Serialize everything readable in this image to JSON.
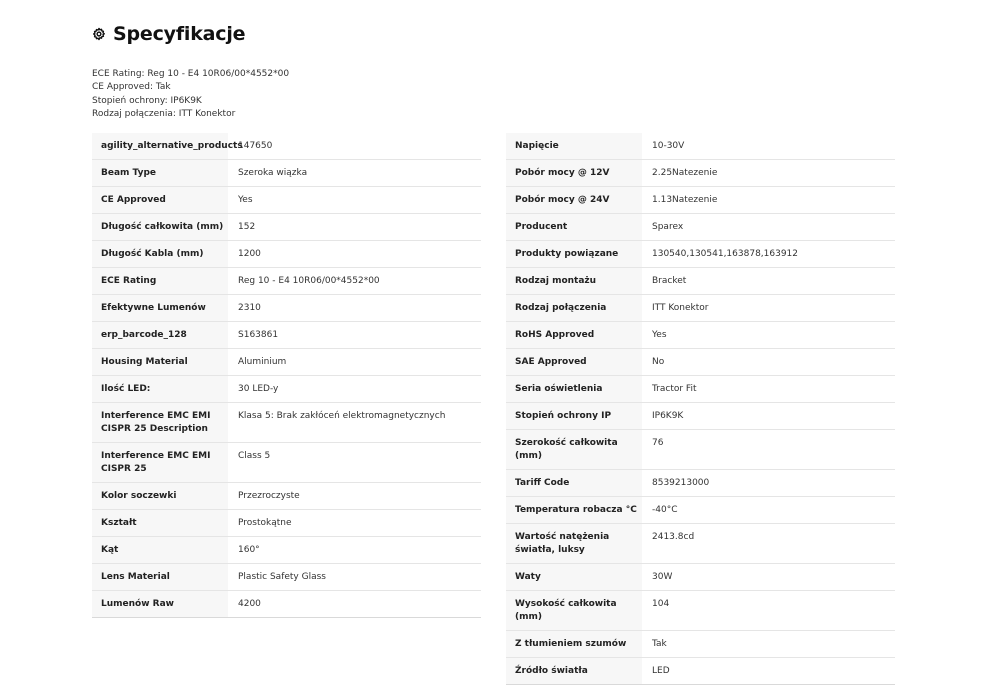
{
  "heading": {
    "icon": "gear-icon",
    "title": "Specyfikacje"
  },
  "summary": [
    "ECE Rating: Reg 10 - E4 10R06/00*4552*00",
    "CE Approved: Tak",
    "Stopień ochrony: IP6K9K",
    "Rodzaj połączenia: ITT Konektor"
  ],
  "left_table": [
    {
      "label": "agility_alternative_products",
      "value": "147650"
    },
    {
      "label": "Beam Type",
      "value": "Szeroka wiązka"
    },
    {
      "label": "CE Approved",
      "value": "Yes"
    },
    {
      "label": "Długość całkowita (mm)",
      "value": "152"
    },
    {
      "label": "Długość Kabla (mm)",
      "value": "1200"
    },
    {
      "label": "ECE Rating",
      "value": "Reg 10 - E4 10R06/00*4552*00"
    },
    {
      "label": "Efektywne Lumenów",
      "value": "2310"
    },
    {
      "label": "erp_barcode_128",
      "value": "S163861"
    },
    {
      "label": "Housing Material",
      "value": "Aluminium"
    },
    {
      "label": "Ilość LED:",
      "value": "30 LED-y"
    },
    {
      "label": "Interference EMC EMI CISPR 25 Description",
      "value": "Klasa 5: Brak zakłóceń elektromagnetycznych"
    },
    {
      "label": "Interference EMC EMI CISPR 25",
      "value": "Class 5"
    },
    {
      "label": "Kolor soczewki",
      "value": "Przezroczyste"
    },
    {
      "label": "Kształt",
      "value": "Prostokątne"
    },
    {
      "label": "Kąt",
      "value": "160°"
    },
    {
      "label": "Lens Material",
      "value": "Plastic Safety Glass"
    },
    {
      "label": "Lumenów Raw",
      "value": "4200"
    }
  ],
  "right_table": [
    {
      "label": "Napięcie",
      "value": "10-30V"
    },
    {
      "label": "Pobór mocy @ 12V",
      "value": "2.25Natezenie"
    },
    {
      "label": "Pobór mocy @ 24V",
      "value": "1.13Natezenie"
    },
    {
      "label": "Producent",
      "value": "Sparex"
    },
    {
      "label": "Produkty powiązane",
      "value": "130540,130541,163878,163912"
    },
    {
      "label": "Rodzaj montażu",
      "value": "Bracket"
    },
    {
      "label": "Rodzaj połączenia",
      "value": "ITT Konektor"
    },
    {
      "label": "RoHS Approved",
      "value": "Yes"
    },
    {
      "label": "SAE Approved",
      "value": "No"
    },
    {
      "label": "Seria oświetlenia",
      "value": "Tractor Fit"
    },
    {
      "label": "Stopień ochrony IP",
      "value": "IP6K9K"
    },
    {
      "label": "Szerokość całkowita (mm)",
      "value": "76"
    },
    {
      "label": "Tariff Code",
      "value": "8539213000"
    },
    {
      "label": "Temperatura robacza °C",
      "value": "-40°C"
    },
    {
      "label": "Wartość natężenia światła, luksy",
      "value": "2413.8cd"
    },
    {
      "label": "Waty",
      "value": "30W"
    },
    {
      "label": "Wysokość całkowita (mm)",
      "value": "104"
    },
    {
      "label": "Z tłumieniem szumów",
      "value": "Tak"
    },
    {
      "label": "Źródło światła",
      "value": "LED"
    }
  ]
}
